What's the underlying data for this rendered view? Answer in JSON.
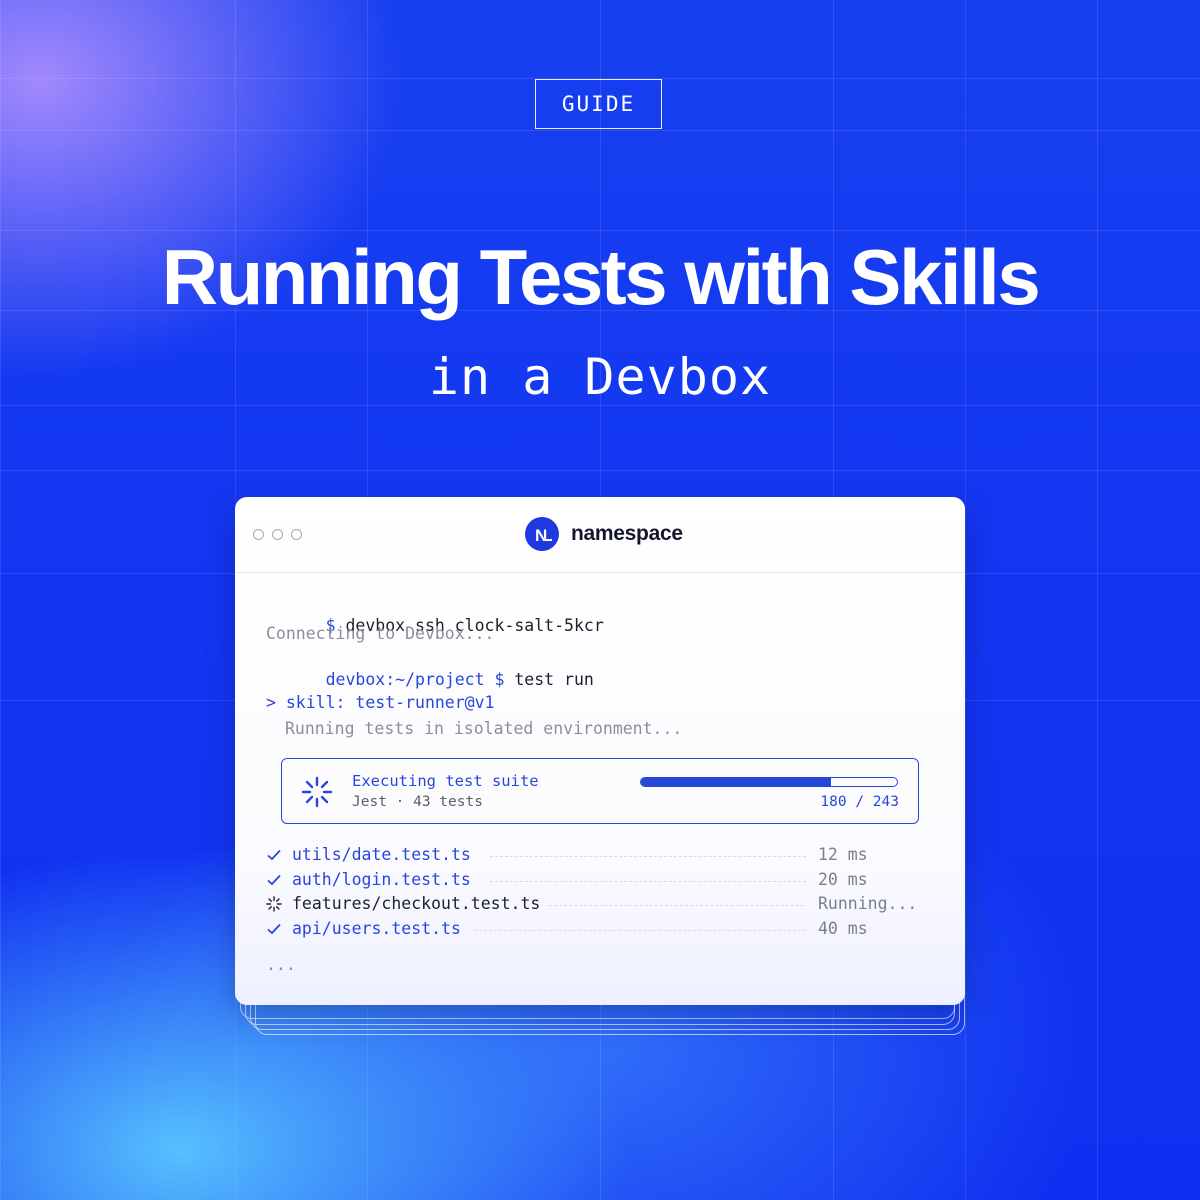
{
  "header": {
    "badge": "GUIDE",
    "title": "Running Tests with Skills",
    "subtitle": "in a Devbox"
  },
  "window": {
    "brand": "namespace",
    "terminal": {
      "cmd1_prompt": "$",
      "cmd1_text": " devbox ssh clock-salt-5kcr",
      "connecting": "Connecting to Devbox...",
      "cmd2_prompt": "devbox:~/project $",
      "cmd2_text": " test run",
      "skill": "> skill: test-runner@v1",
      "running": "Running tests in isolated environment..."
    },
    "execution": {
      "title": "Executing test suite",
      "subtitle": "Jest · 43 tests",
      "progress_done": 180,
      "progress_total": 243,
      "progress_label": "180 / 243"
    },
    "tests": [
      {
        "name": "utils/date.test.ts",
        "time": "12 ms",
        "status": "passed"
      },
      {
        "name": "auth/login.test.ts",
        "time": "20 ms",
        "status": "passed"
      },
      {
        "name": "features/checkout.test.ts",
        "time": "Running...",
        "status": "running"
      },
      {
        "name": "api/users.test.ts",
        "time": "40 ms",
        "status": "passed"
      }
    ],
    "more": "..."
  },
  "colors": {
    "accent": "#2747d9",
    "background": "#1336f2"
  }
}
